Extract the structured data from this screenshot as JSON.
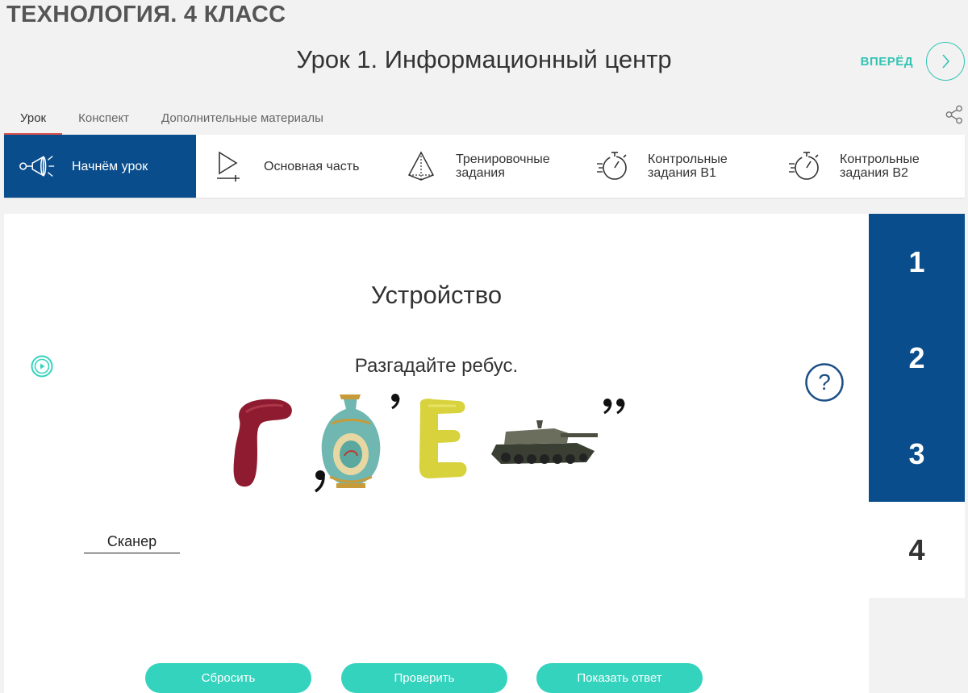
{
  "header": {
    "course_title": "ТЕХНОЛОГИЯ. 4 КЛАСС",
    "lesson_title": "Урок 1. Информационный центр",
    "next_label": "ВПЕРЁД"
  },
  "tabs": [
    {
      "label": "Урок",
      "active": true
    },
    {
      "label": "Конспект",
      "active": false
    },
    {
      "label": "Дополнительные материалы",
      "active": false
    }
  ],
  "stages": [
    {
      "label": "Начнём урок",
      "icon": "megaphone-icon",
      "active": true
    },
    {
      "label": "Основная часть",
      "icon": "play-icon",
      "active": false
    },
    {
      "label": "Тренировочные\nзадания",
      "icon": "pyramid-icon",
      "active": false
    },
    {
      "label": "Контрольные\nзадания В1",
      "icon": "stopwatch-icon",
      "active": false
    },
    {
      "label": "Контрольные\nзадания В2",
      "icon": "stopwatch-icon",
      "active": false
    }
  ],
  "task": {
    "title": "Устройство",
    "instruction": "Разгадайте ребус.",
    "rebus": {
      "letter_1": "Г",
      "letter_2": "Е",
      "pictures": [
        "vase",
        "tank"
      ],
      "marks": [
        ",",
        "’",
        "’’"
      ]
    },
    "answer": "Сканер"
  },
  "buttons": {
    "reset": "Сбросить",
    "check": "Проверить",
    "show_answer": "Показать ответ"
  },
  "steps": [
    "1",
    "2",
    "3",
    "4"
  ],
  "colors": {
    "accent": "#33d3bd",
    "navy": "#0a4d8c",
    "tab_underline": "#d9534f"
  }
}
